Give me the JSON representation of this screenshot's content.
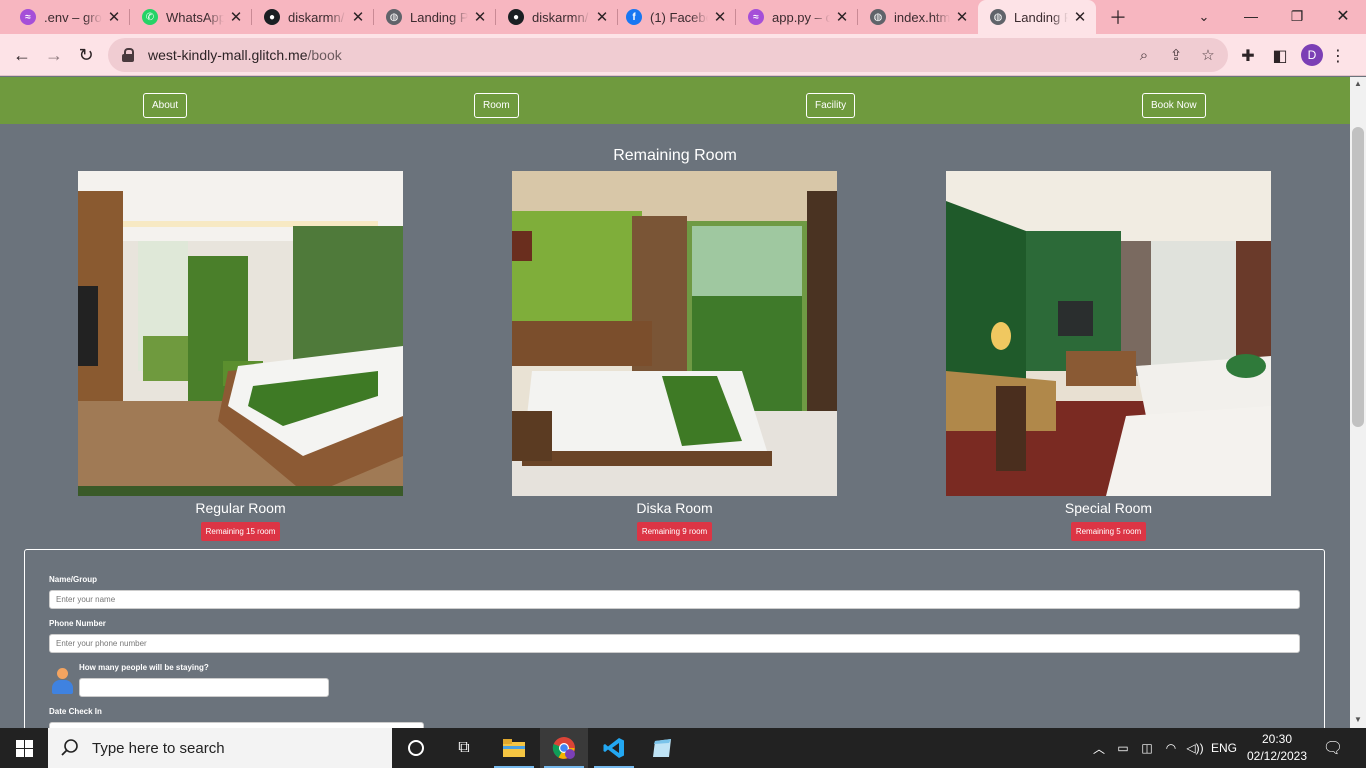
{
  "browser": {
    "tabs": [
      {
        "title": ".env – gro",
        "icon": "glitch-icon"
      },
      {
        "title": "WhatsApp",
        "icon": "whatsapp-icon"
      },
      {
        "title": "diskarmn/",
        "icon": "github-icon"
      },
      {
        "title": "Landing P",
        "icon": "globe-icon"
      },
      {
        "title": "diskarmn/",
        "icon": "github-icon"
      },
      {
        "title": "(1) Facebo",
        "icon": "facebook-icon"
      },
      {
        "title": "app.py – c",
        "icon": "glitch-icon"
      },
      {
        "title": "index.htm",
        "icon": "globe-icon"
      },
      {
        "title": "Landing P",
        "icon": "globe-icon"
      }
    ],
    "active_tab_index": 8,
    "url_host": "west-kindly-mall.glitch.me",
    "url_path": "/book",
    "profile_initial": "D",
    "accent": "#f7b6c0"
  },
  "site": {
    "nav": [
      "About",
      "Room",
      "Facility",
      "Book Now"
    ],
    "heading": "Remaining Room",
    "rooms": [
      {
        "name": "Regular Room",
        "badge": "Remaining 15 room"
      },
      {
        "name": "Diska Room",
        "badge": "Remaining 9 room"
      },
      {
        "name": "Special Room",
        "badge": "Remaining 5 room"
      }
    ],
    "form": {
      "name_label": "Name/Group",
      "name_placeholder": "Enter your name",
      "phone_label": "Phone Number",
      "phone_placeholder": "Enter your phone number",
      "people_label": "How many people will be staying?",
      "checkin_label": "Date Check In"
    },
    "nav_color": "#6f9a3e",
    "badge_color": "#dc3545"
  },
  "taskbar": {
    "search_placeholder": "Type here to search",
    "language": "ENG",
    "time": "20:30",
    "date": "02/12/2023"
  }
}
